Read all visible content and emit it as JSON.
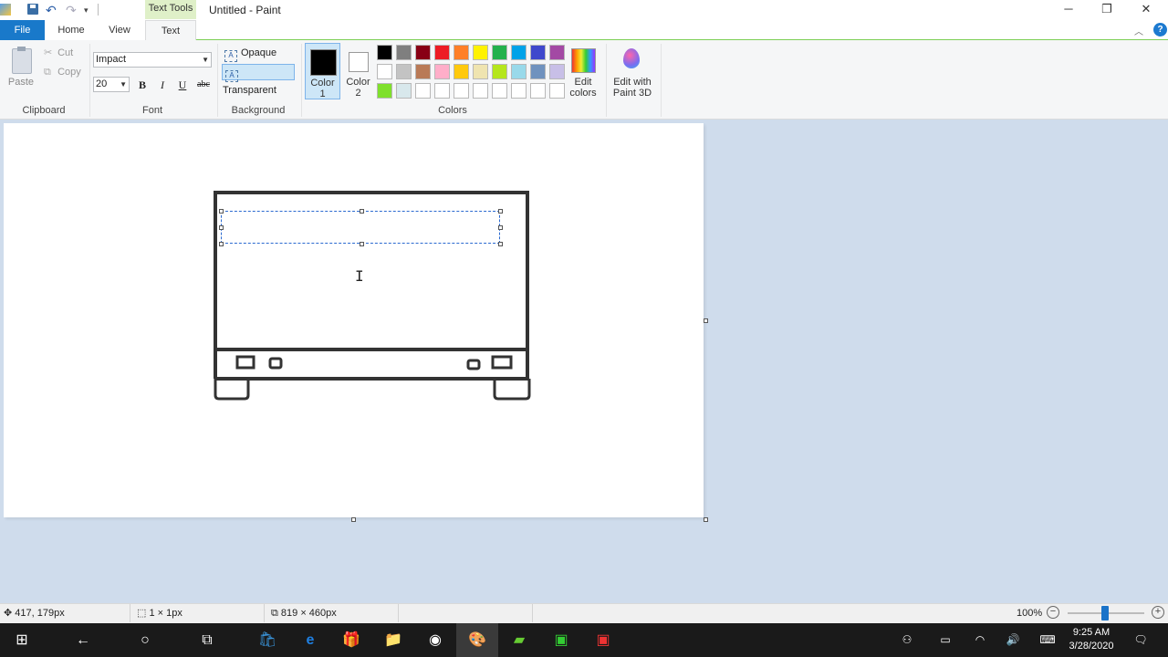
{
  "window": {
    "title": "Untitled - Paint",
    "context_tab": "Text Tools"
  },
  "tabs": {
    "file": "File",
    "home": "Home",
    "view": "View",
    "text": "Text"
  },
  "ribbon": {
    "clipboard": {
      "paste": "Paste",
      "cut": "Cut",
      "copy": "Copy",
      "group": "Clipboard"
    },
    "font": {
      "family": "Impact",
      "size": "20",
      "bold": "B",
      "italic": "I",
      "underline": "U",
      "strike": "abc",
      "group": "Font"
    },
    "background": {
      "opaque": "Opaque",
      "transparent": "Transparent",
      "selected": "Transparent",
      "group": "Background"
    },
    "colors": {
      "color1": "Color\n1",
      "color2": "Color\n2",
      "edit": "Edit\ncolors",
      "group": "Colors",
      "color1_value": "#000000",
      "color2_value": "#ffffff",
      "palette_row1": [
        "#000000",
        "#7f7f7f",
        "#880015",
        "#ed1c24",
        "#ff7f27",
        "#fff200",
        "#22b14c",
        "#00a2e8",
        "#3f48cc",
        "#a349a4"
      ],
      "palette_row2": [
        "#ffffff",
        "#c3c3c3",
        "#b97a57",
        "#ffaec9",
        "#ffc90e",
        "#efe4b0",
        "#b5e61d",
        "#99d9ea",
        "#7092be",
        "#c8bfe7"
      ],
      "palette_row3": [
        "#7fe02c",
        "#d8e8ec",
        "#ffffff",
        "#ffffff",
        "#ffffff",
        "#ffffff",
        "#ffffff",
        "#ffffff",
        "#ffffff",
        "#ffffff"
      ]
    },
    "paint3d": "Edit with\nPaint 3D"
  },
  "status": {
    "cursor_pos": "417, 179px",
    "selection_size": "1 × 1px",
    "canvas_size": "819 × 460px",
    "zoom": "100%",
    "zoom_level": 1.0
  },
  "taskbar": {
    "time": "9:25 AM",
    "date": "3/28/2020"
  }
}
